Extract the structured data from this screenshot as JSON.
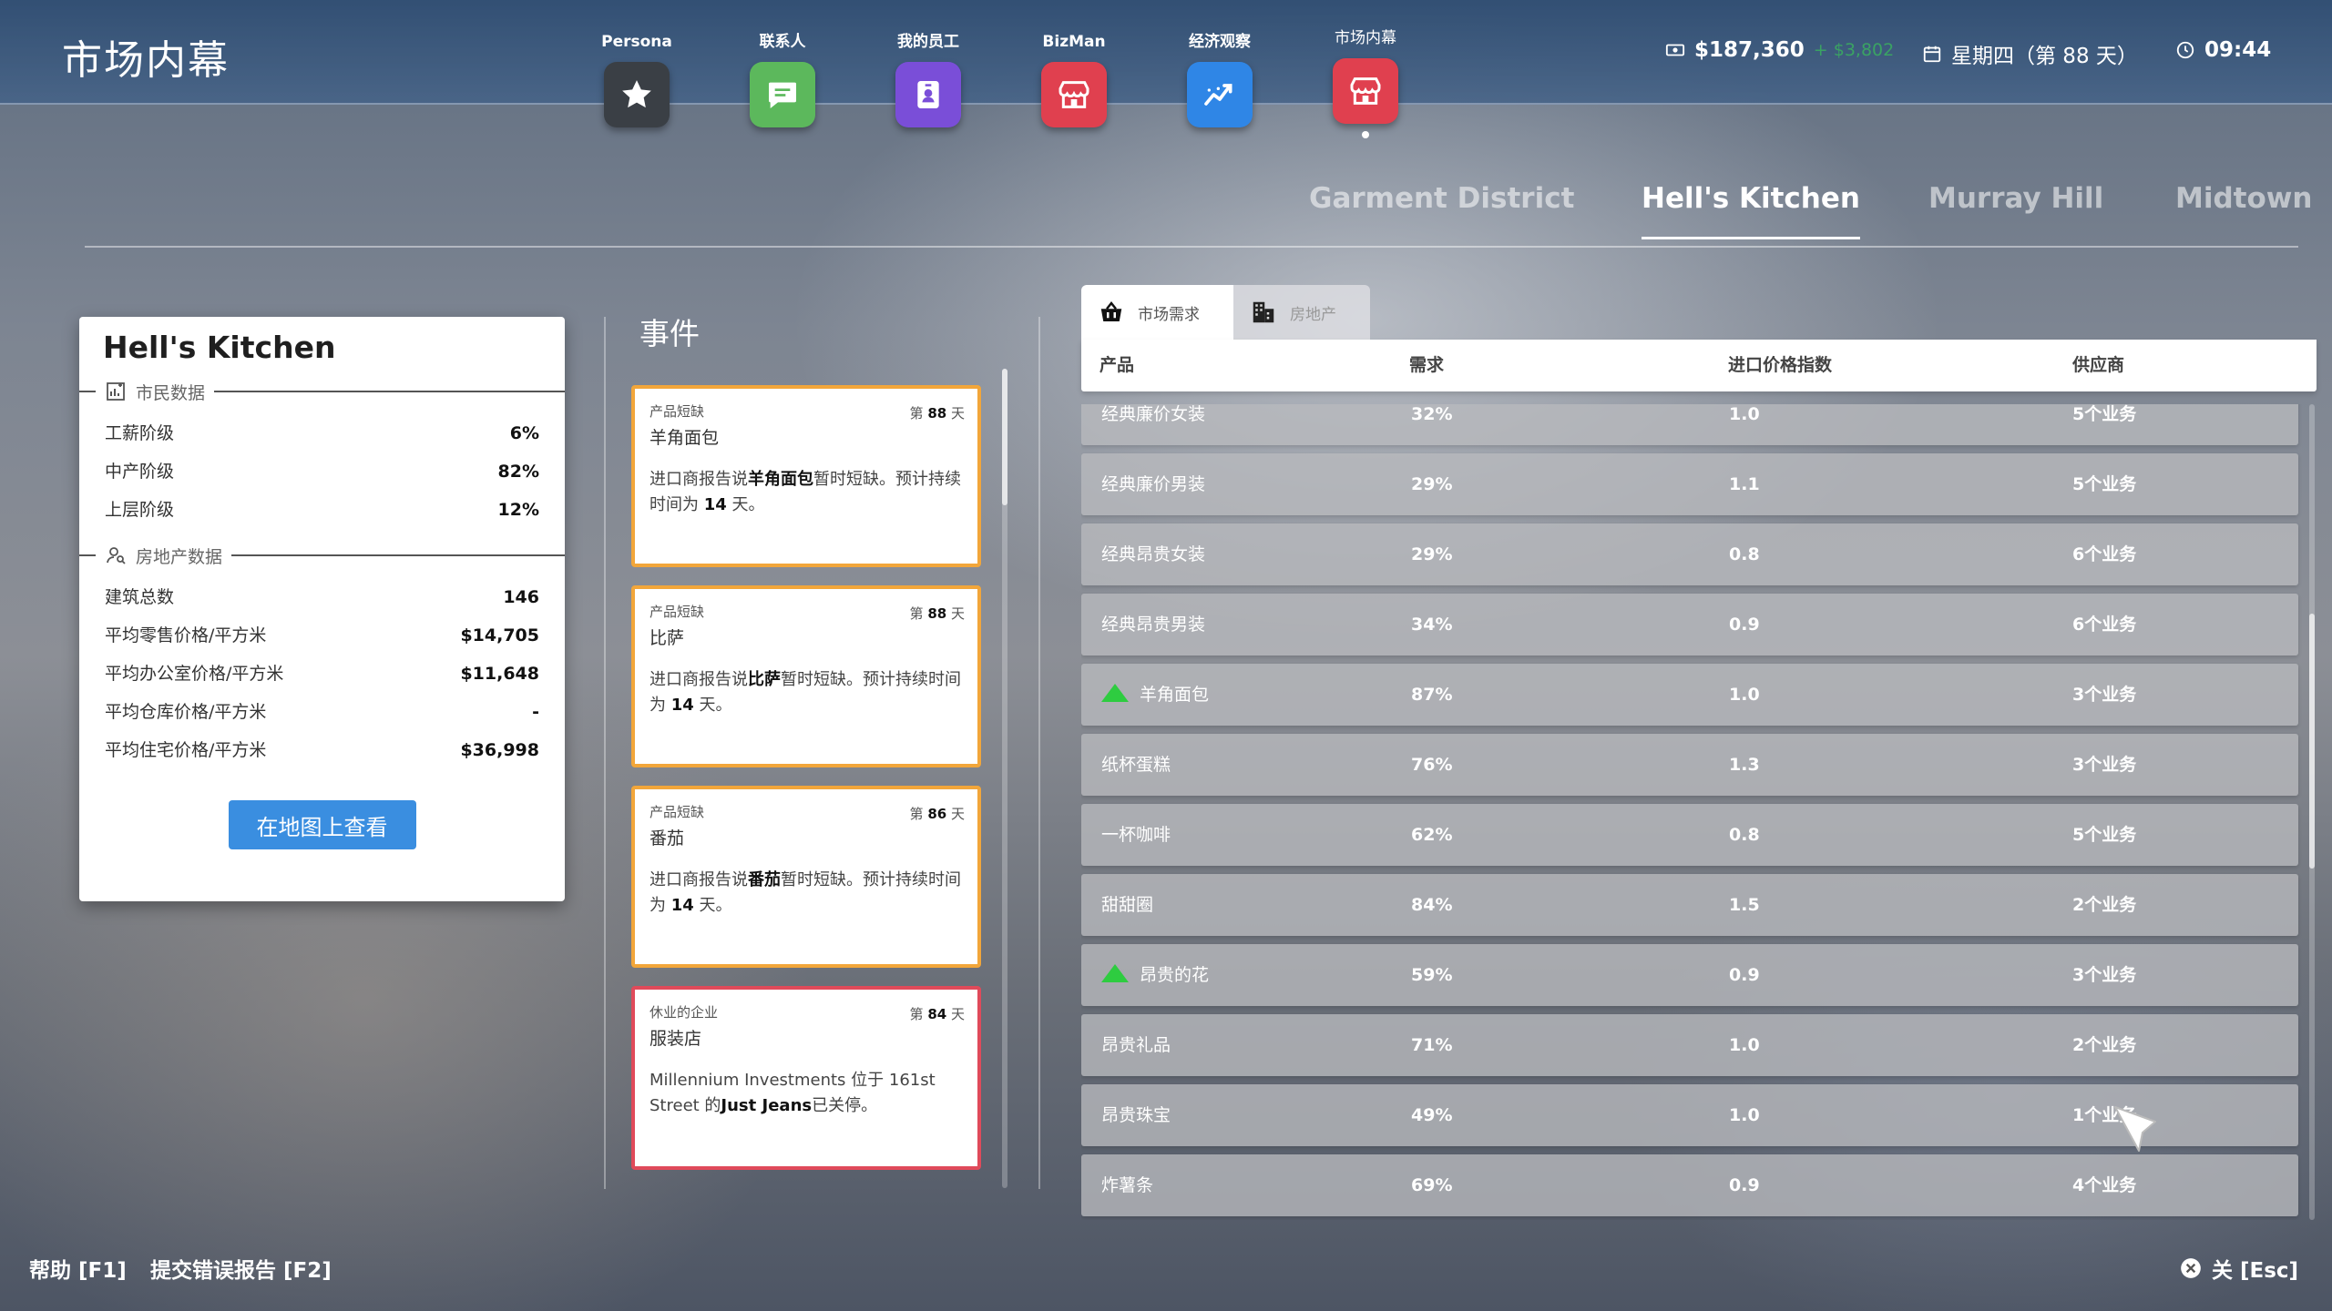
{
  "app": {
    "title": "市场内幕"
  },
  "nav": [
    {
      "label": "Persona",
      "icon": "star-icon",
      "color": "#3a3f45"
    },
    {
      "label": "联系人",
      "icon": "chat-icon",
      "color": "#5cb85c"
    },
    {
      "label": "我的员工",
      "icon": "badge-icon",
      "color": "#7a4ed8"
    },
    {
      "label": "BizMan",
      "icon": "store-icon",
      "color": "#e0404f"
    },
    {
      "label": "经济观察",
      "icon": "trend-icon",
      "color": "#2f86e6"
    },
    {
      "label": "市场内幕",
      "icon": "store-icon",
      "color": "#e0404f",
      "active": true
    }
  ],
  "status": {
    "money": "$187,360",
    "money_delta": "+ $3,802",
    "date": "星期四（第 88 天）",
    "time": "09:44"
  },
  "districts": {
    "tabs": [
      "Garment District",
      "Hell's Kitchen",
      "Murray Hill",
      "Midtown"
    ],
    "active": "Hell's Kitchen"
  },
  "info": {
    "title": "Hell's Kitchen",
    "citizen_section": "市民数据",
    "citizen_rows": [
      {
        "label": "工薪阶级",
        "value": "6%"
      },
      {
        "label": "中产阶级",
        "value": "82%"
      },
      {
        "label": "上层阶级",
        "value": "12%"
      }
    ],
    "estate_section": "房地产数据",
    "estate_rows": [
      {
        "label": "建筑总数",
        "value": "146"
      },
      {
        "label": "平均零售价格/平方米",
        "value": "$14,705"
      },
      {
        "label": "平均办公室价格/平方米",
        "value": "$11,648"
      },
      {
        "label": "平均仓库价格/平方米",
        "value": "-"
      },
      {
        "label": "平均住宅价格/平方米",
        "value": "$36,998"
      }
    ],
    "map_button": "在地图上查看"
  },
  "events": {
    "title": "事件",
    "items": [
      {
        "category": "产品短缺",
        "day_prefix": "第",
        "day": "88",
        "day_suffix": "天",
        "name": "羊角面包",
        "desc_pre": "进口商报告说",
        "desc_bold": "羊角面包",
        "desc_post": "暂时短缺。预计持续时间为",
        "duration": "14",
        "desc_end": "天。",
        "kind": "shortage"
      },
      {
        "category": "产品短缺",
        "day_prefix": "第",
        "day": "88",
        "day_suffix": "天",
        "name": "比萨",
        "desc_pre": "进口商报告说",
        "desc_bold": "比萨",
        "desc_post": "暂时短缺。预计持续时间为",
        "duration": "14",
        "desc_end": "天。",
        "kind": "shortage"
      },
      {
        "category": "产品短缺",
        "day_prefix": "第",
        "day": "86",
        "day_suffix": "天",
        "name": "番茄",
        "desc_pre": "进口商报告说",
        "desc_bold": "番茄",
        "desc_post": "暂时短缺。预计持续时间为",
        "duration": "14",
        "desc_end": "天。",
        "kind": "shortage"
      },
      {
        "category": "休业的企业",
        "day_prefix": "第",
        "day": "84",
        "day_suffix": "天",
        "name": "服装店",
        "desc_pre": "Millennium Investments 位于 161st Street 的",
        "desc_bold": "Just Jeans",
        "desc_post": "已关停。",
        "duration": "",
        "desc_end": "",
        "kind": "closed"
      }
    ]
  },
  "market": {
    "tabs": {
      "demand": "市场需求",
      "realestate": "房地产"
    },
    "columns": {
      "product": "产品",
      "demand": "需求",
      "price_index": "进口价格指数",
      "suppliers": "供应商"
    },
    "rows": [
      {
        "product": "经典廉价女装",
        "demand": "32%",
        "price_index": "1.0",
        "suppliers": "5个业务",
        "trend_up": false
      },
      {
        "product": "经典廉价男装",
        "demand": "29%",
        "price_index": "1.1",
        "suppliers": "5个业务",
        "trend_up": false
      },
      {
        "product": "经典昂贵女装",
        "demand": "29%",
        "price_index": "0.8",
        "suppliers": "6个业务",
        "trend_up": false
      },
      {
        "product": "经典昂贵男装",
        "demand": "34%",
        "price_index": "0.9",
        "suppliers": "6个业务",
        "trend_up": false
      },
      {
        "product": "羊角面包",
        "demand": "87%",
        "price_index": "1.0",
        "suppliers": "3个业务",
        "trend_up": true
      },
      {
        "product": "纸杯蛋糕",
        "demand": "76%",
        "price_index": "1.3",
        "suppliers": "3个业务",
        "trend_up": false
      },
      {
        "product": "一杯咖啡",
        "demand": "62%",
        "price_index": "0.8",
        "suppliers": "5个业务",
        "trend_up": false
      },
      {
        "product": "甜甜圈",
        "demand": "84%",
        "price_index": "1.5",
        "suppliers": "2个业务",
        "trend_up": false
      },
      {
        "product": "昂贵的花",
        "demand": "59%",
        "price_index": "0.9",
        "suppliers": "3个业务",
        "trend_up": true
      },
      {
        "product": "昂贵礼品",
        "demand": "71%",
        "price_index": "1.0",
        "suppliers": "2个业务",
        "trend_up": false
      },
      {
        "product": "昂贵珠宝",
        "demand": "49%",
        "price_index": "1.0",
        "suppliers": "1个业务",
        "trend_up": false
      },
      {
        "product": "炸薯条",
        "demand": "69%",
        "price_index": "0.9",
        "suppliers": "4个业务",
        "trend_up": false
      }
    ]
  },
  "footer": {
    "help": "帮助 [F1]",
    "bug_report": "提交错误报告 [F2]",
    "close": "关 [Esc]"
  }
}
